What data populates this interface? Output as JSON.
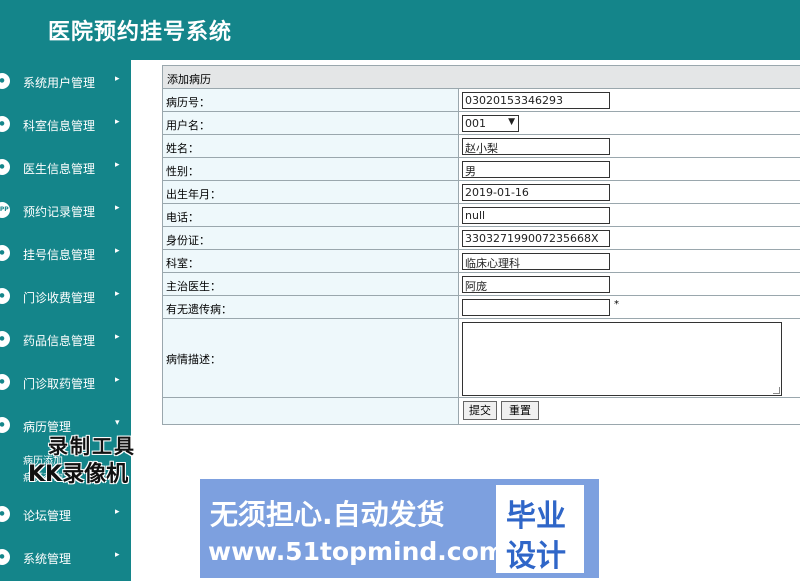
{
  "header": {
    "title": "医院预约挂号系统"
  },
  "sidebar": {
    "items": [
      {
        "label": "系统用户管理",
        "icon": "user-icon",
        "arrow": "▸"
      },
      {
        "label": "科室信息管理",
        "icon": "department-icon",
        "arrow": "▸"
      },
      {
        "label": "医生信息管理",
        "icon": "doctor-icon",
        "arrow": "▸"
      },
      {
        "label": "预约记录管理",
        "icon": "app-icon",
        "arrow": "▸"
      },
      {
        "label": "挂号信息管理",
        "icon": "register-icon",
        "arrow": "▸"
      },
      {
        "label": "门诊收费管理",
        "icon": "fee-icon",
        "arrow": "▸"
      },
      {
        "label": "药品信息管理",
        "icon": "medicine-icon",
        "arrow": "▸"
      },
      {
        "label": "门诊取药管理",
        "icon": "pharmacy-icon",
        "arrow": "▸"
      },
      {
        "label": "病历管理",
        "icon": "record-icon",
        "arrow": "▾"
      },
      {
        "label": "论坛管理",
        "icon": "forum-icon",
        "arrow": "▸"
      },
      {
        "label": "系统管理",
        "icon": "settings-icon",
        "arrow": "▸"
      }
    ],
    "sub_items": [
      "病历添加",
      "病历查询"
    ]
  },
  "form": {
    "title": "添加病历",
    "rows": [
      {
        "label": "病历号：",
        "value": "03020153346293"
      },
      {
        "label": "用户名：",
        "value": "001"
      },
      {
        "label": "姓名：",
        "value": "赵小梨"
      },
      {
        "label": "性别：",
        "value": "男"
      },
      {
        "label": "出生年月：",
        "value": "2019-01-16"
      },
      {
        "label": "电话：",
        "value": "null"
      },
      {
        "label": "身份证：",
        "value": "330327199007235668X"
      },
      {
        "label": "科室：",
        "value": "临床心理科"
      },
      {
        "label": "主治医生：",
        "value": "阿庞"
      },
      {
        "label": "有无遗传病：",
        "value": ""
      }
    ],
    "description_label": "病情描述：",
    "required_mark": "*",
    "submit_label": "提交",
    "reset_label": "重置",
    "select_arrow": "▼"
  },
  "watermarks": {
    "recorder_line1": "录制工具",
    "recorder_line2": "KK录像机",
    "slogan": "无须担心.自动发货",
    "url": "www.51topmind.com",
    "box_line1": "毕业",
    "box_line2": "设计"
  },
  "colors": {
    "teal": "#14858a",
    "label_bg": "#eef8fb",
    "banner_blue": "#7da0df"
  }
}
